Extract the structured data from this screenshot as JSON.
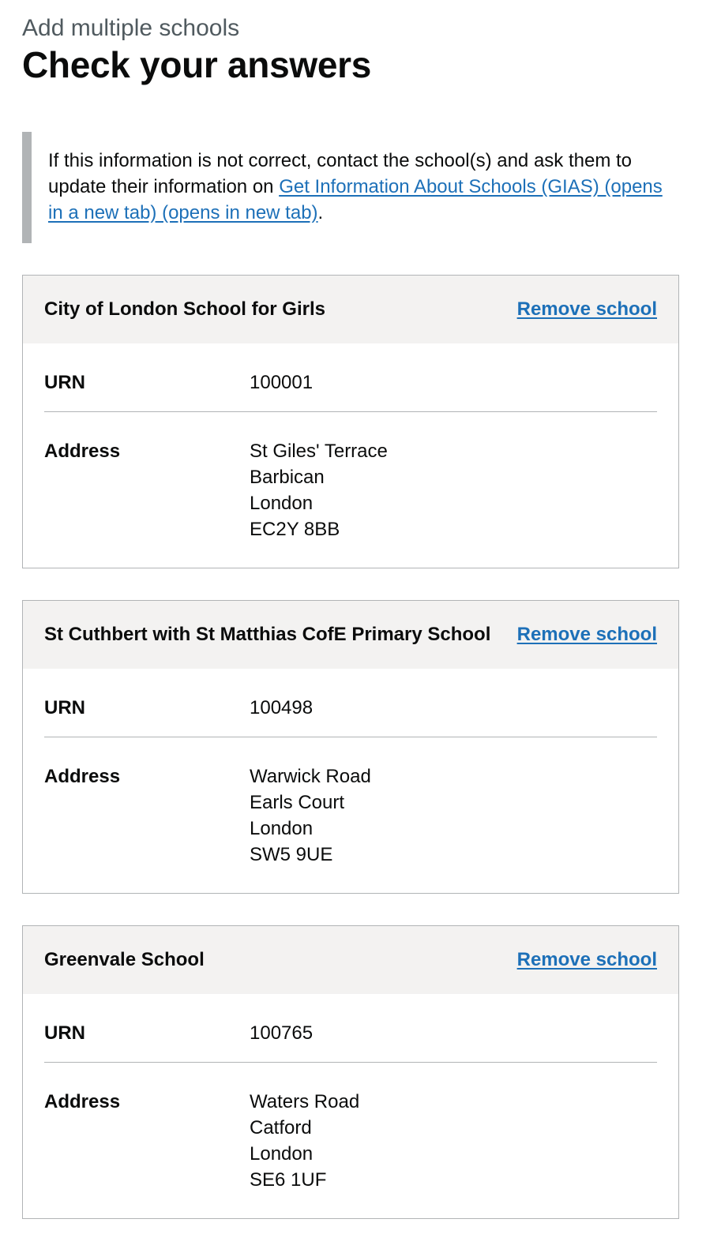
{
  "header": {
    "caption": "Add multiple schools",
    "title": "Check your answers"
  },
  "inset": {
    "text_before": "If this information is not correct, contact the school(s) and ask them to update their information on ",
    "link_text": "Get Information About Schools (GIAS) (opens in a new tab) (opens in new tab)",
    "text_after": "."
  },
  "schools": [
    {
      "name": "City of London School for Girls",
      "action": "Remove school",
      "urn_label": "URN",
      "urn": "100001",
      "address_label": "Address",
      "address": [
        "St Giles' Terrace",
        "Barbican",
        "London",
        "EC2Y 8BB"
      ]
    },
    {
      "name": "St Cuthbert with St Matthias CofE Primary School",
      "action": "Remove school",
      "urn_label": "URN",
      "urn": "100498",
      "address_label": "Address",
      "address": [
        "Warwick Road",
        "Earls Court",
        "London",
        "SW5 9UE"
      ]
    },
    {
      "name": "Greenvale School",
      "action": "Remove school",
      "urn_label": "URN",
      "urn": "100765",
      "address_label": "Address",
      "address": [
        "Waters Road",
        "Catford",
        "London",
        "SE6 1UF"
      ]
    }
  ],
  "colors": {
    "text": "#0b0c0c",
    "caption": "#505a5f",
    "link": "#1d70b8",
    "card_header_bg": "#f3f2f1",
    "border": "#b1b4b6"
  }
}
